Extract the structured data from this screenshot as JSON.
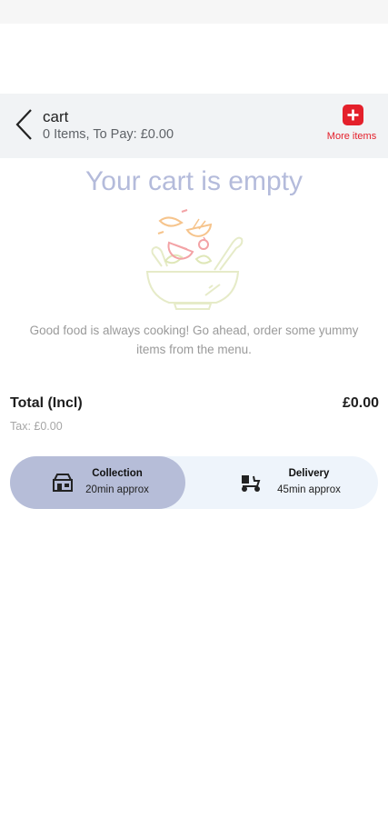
{
  "header": {
    "title": "cart",
    "subtitle": "0 Items, To Pay: £0.00",
    "more_items_label": "More items",
    "back_icon": "chevron-left-icon",
    "more_icon": "plus-icon"
  },
  "empty_state": {
    "title": "Your cart is empty",
    "message": "Good food is always cooking! Go ahead, order some yummy items from the menu.",
    "illustration": "salad-bowl-illustration"
  },
  "totals": {
    "total_label": "Total (Incl)",
    "total_value": "£0.00",
    "tax_text": "Tax: £0.00"
  },
  "order_modes": [
    {
      "name": "Collection",
      "time": "20min approx",
      "selected": true,
      "icon": "store-icon"
    },
    {
      "name": "Delivery",
      "time": "45min approx",
      "selected": false,
      "icon": "scooter-icon"
    }
  ],
  "colors": {
    "accent": "#e4202b",
    "empty_title": "#b4bbdb",
    "selected_mode_bg": "#b6bdd8",
    "toggle_bg": "#eef4fb",
    "header_bg": "#f1f3f5"
  }
}
